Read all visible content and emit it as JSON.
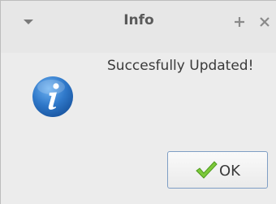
{
  "window": {
    "title": "Info",
    "menu_icon": "chevron-down-icon",
    "maximize_icon": "plus-icon",
    "close_icon": "close-icon"
  },
  "dialog": {
    "icon": "info-icon",
    "message": "Succesfully Updated!",
    "ok_label": "OK",
    "ok_icon": "checkmark-icon"
  },
  "colors": {
    "accent_blue": "#2f78c9",
    "check_green": "#7cc93a",
    "background": "#ececec"
  }
}
